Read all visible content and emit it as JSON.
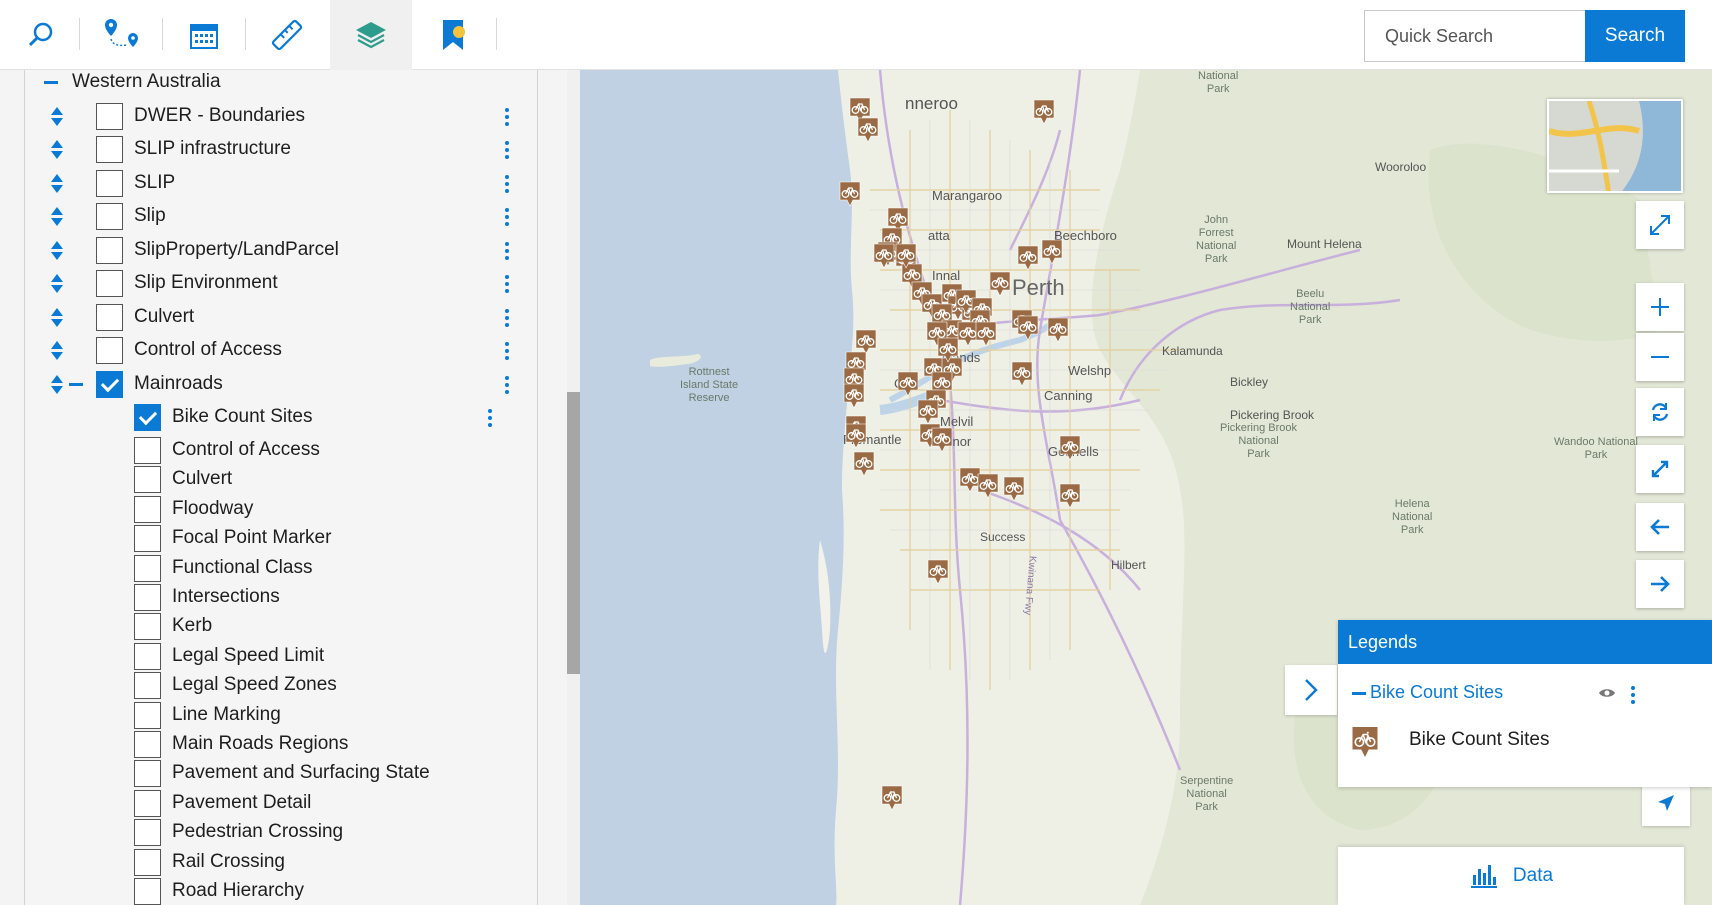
{
  "toolbar": {
    "icons": [
      "search-icon",
      "route-icon",
      "calendar-icon",
      "ruler-icon",
      "layers-icon",
      "bookmark-icon"
    ],
    "search_placeholder": "Quick Search",
    "search_label": "Search"
  },
  "layers": {
    "group": "Western Australia",
    "items": [
      {
        "label": "DWER - Boundaries",
        "checked": false
      },
      {
        "label": "SLIP infrastructure",
        "checked": false
      },
      {
        "label": "SLIP",
        "checked": false
      },
      {
        "label": "Slip",
        "checked": false
      },
      {
        "label": "SlipProperty/LandParcel",
        "checked": false
      },
      {
        "label": "Slip Environment",
        "checked": false
      },
      {
        "label": "Culvert",
        "checked": false
      },
      {
        "label": "Control of Access",
        "checked": false
      },
      {
        "label": "Mainroads",
        "checked": true
      }
    ],
    "sublayers": [
      {
        "label": "Bike Count Sites",
        "checked": true
      },
      {
        "label": "Control of Access",
        "checked": false
      },
      {
        "label": "Culvert",
        "checked": false
      },
      {
        "label": "Floodway",
        "checked": false
      },
      {
        "label": "Focal Point Marker",
        "checked": false
      },
      {
        "label": "Functional Class",
        "checked": false
      },
      {
        "label": "Intersections",
        "checked": false
      },
      {
        "label": "Kerb",
        "checked": false
      },
      {
        "label": "Legal Speed Limit",
        "checked": false
      },
      {
        "label": "Legal Speed Zones",
        "checked": false
      },
      {
        "label": "Line Marking",
        "checked": false
      },
      {
        "label": "Main Roads Regions",
        "checked": false
      },
      {
        "label": "Pavement and Surfacing State",
        "checked": false
      },
      {
        "label": "Pavement Detail",
        "checked": false
      },
      {
        "label": "Pedestrian Crossing",
        "checked": false
      },
      {
        "label": "Rail Crossing",
        "checked": false
      },
      {
        "label": "Road Hierarchy",
        "checked": false
      }
    ]
  },
  "map": {
    "labels": {
      "perth": "Perth",
      "joondalup": "nneroo",
      "marangaroo": "Marangaroo",
      "beechboro": "Beechboro",
      "wooroloo": "Wooroloo",
      "mount_helena": "Mount Helena",
      "kalamunda": "Kalamunda",
      "bickley": "Bickley",
      "pickering": "Pickering Brook",
      "fremantle": "Fremantle",
      "gosnells": "Gosnells",
      "success": "Success",
      "hilbert": "Hilbert",
      "welshpool": "Welshp",
      "cannington": "Canning",
      "melville": "Melvil",
      "dalkeith": "dlands",
      "atta": "atta",
      "nnaloo": "Innal",
      "oconnor": "onnor",
      "cottesloe": "Co",
      "kwinana": "Kwinana Fwy"
    },
    "parks": {
      "national": "National\nPark",
      "rottnest": "Rottnest\nIsland State\nReserve",
      "john_forrest": "John\nForrest\nNational\nPark",
      "beelu": "Beelu\nNational\nPark",
      "pickering_park": "Pickering Brook\nNational\nPark",
      "wandoo": "Wandoo National\nPark",
      "helena": "Helena\nNational\nPark",
      "serpentine": "Serpentine\nNational\nPark"
    },
    "marker_icon": "bike-icon",
    "accent": "#0a7ad4",
    "marker_color": "#9a6a45"
  },
  "legend": {
    "title": "Legends",
    "layer": "Bike Count Sites",
    "entry": "Bike Count Sites"
  },
  "data_button": "Data"
}
